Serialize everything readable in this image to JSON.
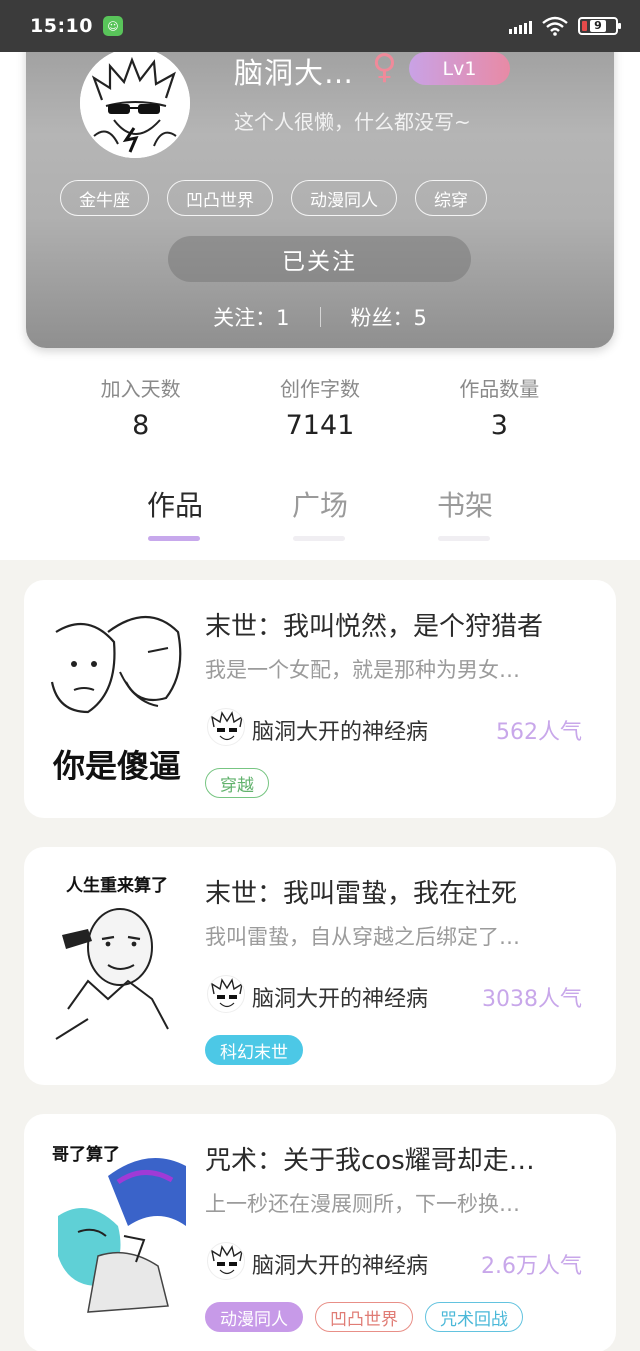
{
  "status_bar": {
    "time": "15:10",
    "battery": "9"
  },
  "profile": {
    "nickname": "脑洞大…",
    "gender_symbol": "♀",
    "level": "Lv1",
    "bio": "这个人很懒，什么都没写~",
    "tags": [
      "金牛座",
      "凹凸世界",
      "动漫同人",
      "综穿"
    ],
    "follow_button": "已关注",
    "following_label": "关注：1",
    "fans_label": "粉丝：5"
  },
  "stats": [
    {
      "label": "加入天数",
      "value": "8"
    },
    {
      "label": "创作字数",
      "value": "7141"
    },
    {
      "label": "作品数量",
      "value": "3"
    }
  ],
  "tabs": [
    "作品",
    "广场",
    "书架"
  ],
  "works": [
    {
      "title": "末世：我叫悦然，是个狩猎者",
      "desc": "我是一个女配，就是那种为男女…",
      "author": "脑洞大开的神经病",
      "popularity": "562人气",
      "cover_text": "你是傻逼",
      "tags": [
        {
          "label": "穿越",
          "style": "green"
        }
      ]
    },
    {
      "title": "末世：我叫雷蛰，我在社死",
      "desc": "我叫雷蛰，自从穿越之后绑定了…",
      "author": "脑洞大开的神经病",
      "popularity": "3038人气",
      "cover_text": "人生重来算了",
      "tags": [
        {
          "label": "科幻末世",
          "style": "cyan"
        }
      ]
    },
    {
      "title": "咒术：关于我cos耀哥却走…",
      "desc": "上一秒还在漫展厕所，下一秒换…",
      "author": "脑洞大开的神经病",
      "popularity": "2.6万人气",
      "cover_text": "哥了算了",
      "tags": [
        {
          "label": "动漫同人",
          "style": "purple"
        },
        {
          "label": "凹凸世界",
          "style": "red"
        },
        {
          "label": "咒术回战",
          "style": "teal"
        }
      ]
    }
  ]
}
